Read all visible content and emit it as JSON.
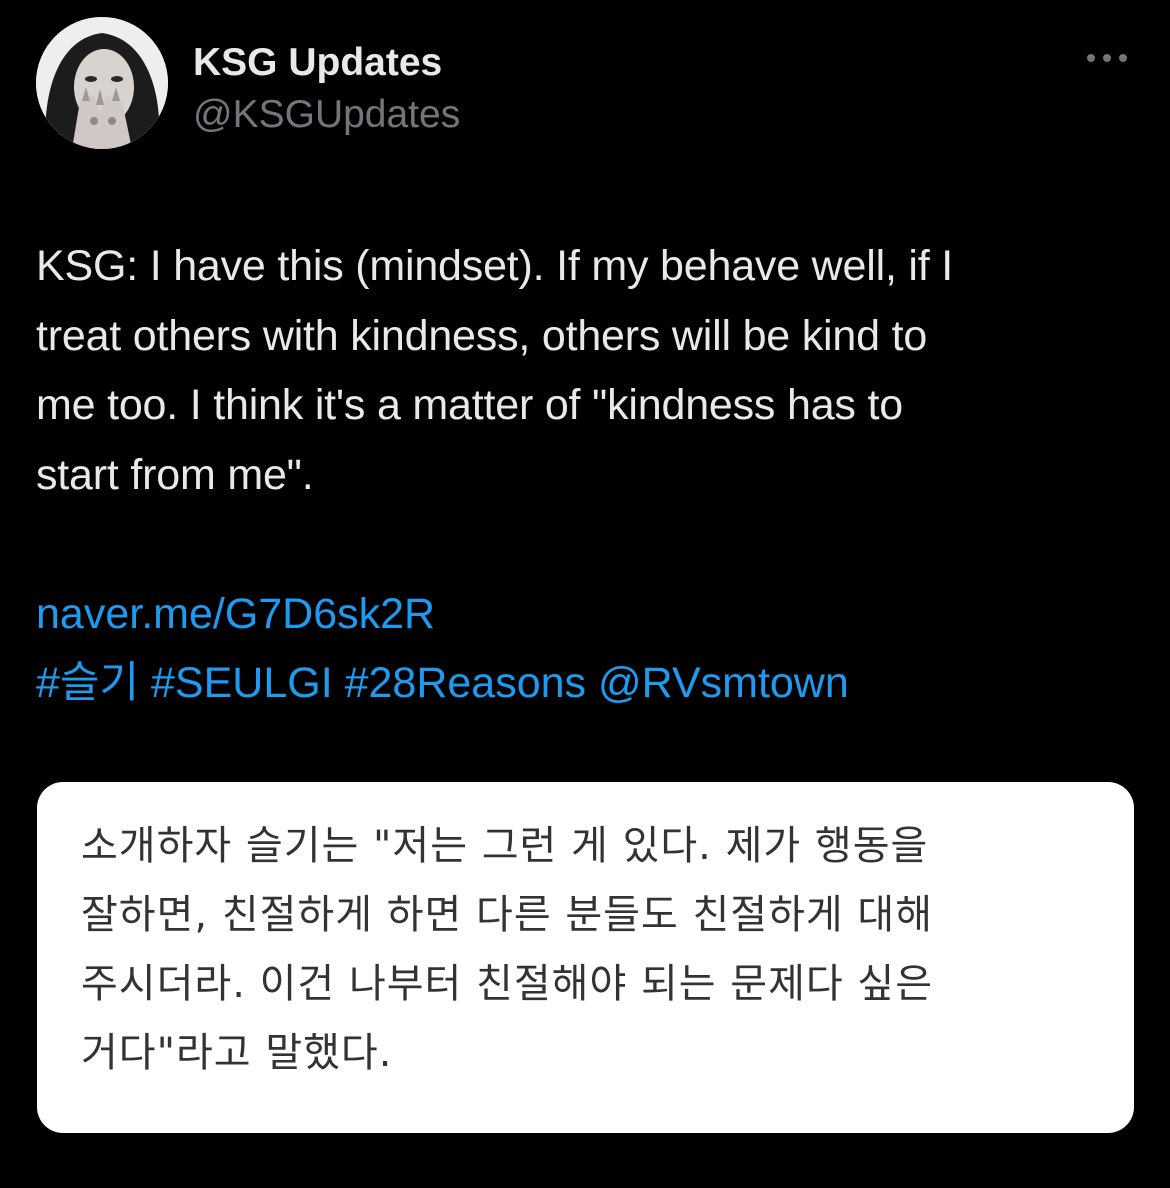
{
  "author": {
    "name": "KSG Updates",
    "handle": "@KSGUpdates",
    "avatar_icon": "profile-photo"
  },
  "more_icon": "ellipsis-icon",
  "tweet": {
    "lines": [
      "KSG: I have this (mindset). If my behave well, if I",
      "treat others with kindness, others will be kind to",
      "me too. I think it's a matter of \"kindness has to",
      "start from me\"."
    ],
    "url": "naver.me/G7D6sk2R",
    "tags": [
      "#슬기",
      "#SEULGI",
      "#28Reasons",
      "@RVsmtown"
    ]
  },
  "quote_image": {
    "lines": [
      "소개하자 슬기는 \"저는 그런 게 있다. 제가 행동을",
      "잘하면, 친절하게 하면 다른 분들도 친절하게 대해",
      "주시더라. 이건 나부터 친절해야 되는 문제다 싶은",
      "거다\"라고 말했다."
    ]
  },
  "colors": {
    "background": "#000000",
    "primary_text": "#e7e9ea",
    "secondary_text": "#71767b",
    "link": "#1d9bf0",
    "card_background": "#ffffff",
    "card_text": "#333333"
  }
}
